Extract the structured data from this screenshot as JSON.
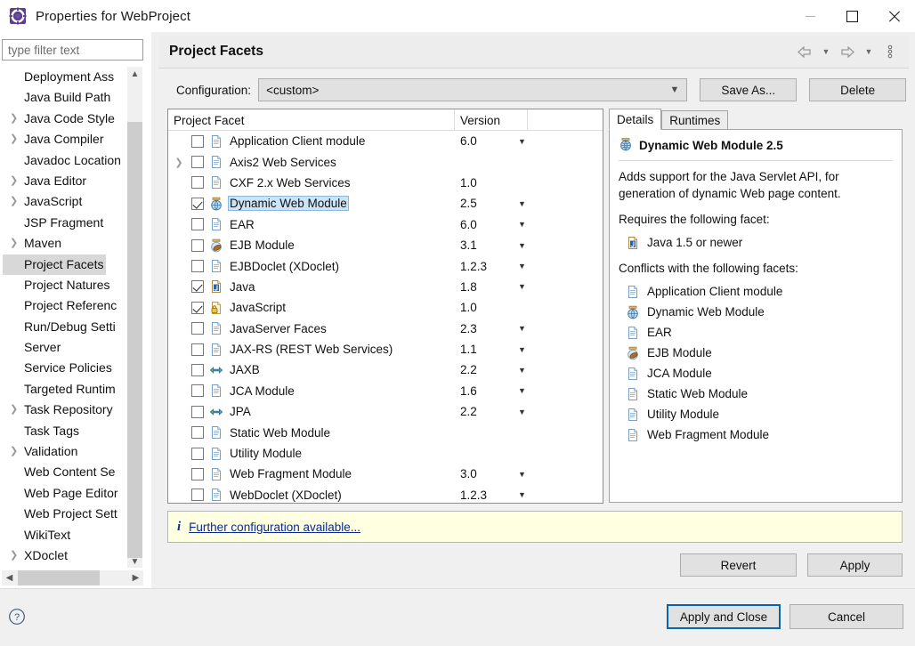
{
  "window": {
    "title": "Properties for WebProject",
    "app_icon": "eclipse-properties-icon",
    "minimize": "minimize-icon",
    "maximize": "maximize-icon",
    "close": "close-icon"
  },
  "sidebar": {
    "filter_placeholder": "type filter text",
    "filter_value": "",
    "items": [
      {
        "label": "Deployment Ass",
        "expandable": false,
        "selected": false
      },
      {
        "label": "Java Build Path",
        "expandable": false,
        "selected": false
      },
      {
        "label": "Java Code Style",
        "expandable": true,
        "selected": false
      },
      {
        "label": "Java Compiler",
        "expandable": true,
        "selected": false
      },
      {
        "label": "Javadoc Location",
        "expandable": false,
        "selected": false
      },
      {
        "label": "Java Editor",
        "expandable": true,
        "selected": false
      },
      {
        "label": "JavaScript",
        "expandable": true,
        "selected": false
      },
      {
        "label": "JSP Fragment",
        "expandable": false,
        "selected": false
      },
      {
        "label": "Maven",
        "expandable": true,
        "selected": false
      },
      {
        "label": "Project Facets",
        "expandable": false,
        "selected": true
      },
      {
        "label": "Project Natures",
        "expandable": false,
        "selected": false
      },
      {
        "label": "Project Referenc",
        "expandable": false,
        "selected": false
      },
      {
        "label": "Run/Debug Setti",
        "expandable": false,
        "selected": false
      },
      {
        "label": "Server",
        "expandable": false,
        "selected": false
      },
      {
        "label": "Service Policies",
        "expandable": false,
        "selected": false
      },
      {
        "label": "Targeted Runtim",
        "expandable": false,
        "selected": false
      },
      {
        "label": "Task Repository",
        "expandable": true,
        "selected": false
      },
      {
        "label": "Task Tags",
        "expandable": false,
        "selected": false
      },
      {
        "label": "Validation",
        "expandable": true,
        "selected": false
      },
      {
        "label": "Web Content Se",
        "expandable": false,
        "selected": false
      },
      {
        "label": "Web Page Editor",
        "expandable": false,
        "selected": false
      },
      {
        "label": "Web Project Sett",
        "expandable": false,
        "selected": false
      },
      {
        "label": "WikiText",
        "expandable": false,
        "selected": false
      },
      {
        "label": "XDoclet",
        "expandable": true,
        "selected": false
      }
    ],
    "scroll_up": "scroll-up-arrow",
    "scroll_down": "scroll-down-arrow",
    "scroll_left": "scroll-left-arrow",
    "scroll_right": "scroll-right-arrow"
  },
  "page": {
    "title": "Project Facets",
    "nav_back": "back-arrow-icon",
    "nav_forward": "forward-arrow-icon",
    "menu": "view-menu-icon"
  },
  "configuration": {
    "label": "Configuration:",
    "value": "<custom>",
    "save_as_label": "Save As...",
    "delete_label": "Delete"
  },
  "facets_table": {
    "columns": [
      "Project Facet",
      "Version"
    ],
    "rows": [
      {
        "name": "Application Client module",
        "version": "6.0",
        "checked": false,
        "expandable": false,
        "has_version_menu": true,
        "icon": "doc-icon"
      },
      {
        "name": "Axis2 Web Services",
        "version": "",
        "checked": false,
        "expandable": true,
        "has_version_menu": false,
        "icon": "doc-icon"
      },
      {
        "name": "CXF 2.x Web Services",
        "version": "1.0",
        "checked": false,
        "expandable": false,
        "has_version_menu": false,
        "icon": "doc-icon"
      },
      {
        "name": "Dynamic Web Module",
        "version": "2.5",
        "checked": true,
        "expandable": false,
        "has_version_menu": true,
        "icon": "web-module-icon",
        "selected": true
      },
      {
        "name": "EAR",
        "version": "6.0",
        "checked": false,
        "expandable": false,
        "has_version_menu": true,
        "icon": "doc-icon"
      },
      {
        "name": "EJB Module",
        "version": "3.1",
        "checked": false,
        "expandable": false,
        "has_version_menu": true,
        "icon": "ejb-module-icon"
      },
      {
        "name": "EJBDoclet (XDoclet)",
        "version": "1.2.3",
        "checked": false,
        "expandable": false,
        "has_version_menu": true,
        "icon": "doc-icon"
      },
      {
        "name": "Java",
        "version": "1.8",
        "checked": true,
        "expandable": false,
        "has_version_menu": true,
        "icon": "java-icon"
      },
      {
        "name": "JavaScript",
        "version": "1.0",
        "checked": true,
        "expandable": false,
        "has_version_menu": false,
        "icon": "javascript-icon"
      },
      {
        "name": "JavaServer Faces",
        "version": "2.3",
        "checked": false,
        "expandable": false,
        "has_version_menu": true,
        "icon": "doc-icon"
      },
      {
        "name": "JAX-RS (REST Web Services)",
        "version": "1.1",
        "checked": false,
        "expandable": false,
        "has_version_menu": true,
        "icon": "doc-icon"
      },
      {
        "name": "JAXB",
        "version": "2.2",
        "checked": false,
        "expandable": false,
        "has_version_menu": true,
        "icon": "jaxb-icon"
      },
      {
        "name": "JCA Module",
        "version": "1.6",
        "checked": false,
        "expandable": false,
        "has_version_menu": true,
        "icon": "doc-icon"
      },
      {
        "name": "JPA",
        "version": "2.2",
        "checked": false,
        "expandable": false,
        "has_version_menu": true,
        "icon": "jaxb-icon"
      },
      {
        "name": "Static Web Module",
        "version": "",
        "checked": false,
        "expandable": false,
        "has_version_menu": false,
        "icon": "doc-icon"
      },
      {
        "name": "Utility Module",
        "version": "",
        "checked": false,
        "expandable": false,
        "has_version_menu": false,
        "icon": "doc-icon"
      },
      {
        "name": "Web Fragment Module",
        "version": "3.0",
        "checked": false,
        "expandable": false,
        "has_version_menu": true,
        "icon": "doc-icon"
      },
      {
        "name": "WebDoclet (XDoclet)",
        "version": "1.2.3",
        "checked": false,
        "expandable": false,
        "has_version_menu": true,
        "icon": "doc-icon"
      }
    ]
  },
  "details": {
    "tabs": [
      {
        "label": "Details",
        "active": true
      },
      {
        "label": "Runtimes",
        "active": false
      }
    ],
    "title": "Dynamic Web Module 2.5",
    "title_icon": "web-module-icon",
    "description": "Adds support for the Java Servlet API, for generation of dynamic Web page content.",
    "requires_heading": "Requires the following facet:",
    "requires": [
      {
        "label": "Java 1.5 or newer",
        "icon": "java-icon"
      }
    ],
    "conflicts_heading": "Conflicts with the following facets:",
    "conflicts": [
      {
        "label": "Application Client module",
        "icon": "doc-icon"
      },
      {
        "label": "Dynamic Web Module",
        "icon": "web-module-icon"
      },
      {
        "label": "EAR",
        "icon": "doc-icon"
      },
      {
        "label": "EJB Module",
        "icon": "ejb-module-icon"
      },
      {
        "label": "JCA Module",
        "icon": "doc-icon"
      },
      {
        "label": "Static Web Module",
        "icon": "doc-icon"
      },
      {
        "label": "Utility Module",
        "icon": "doc-icon"
      },
      {
        "label": "Web Fragment Module",
        "icon": "doc-icon"
      }
    ]
  },
  "info_bar": {
    "icon": "info-icon",
    "link_text": "Further configuration available...",
    "background": "#ffffe1"
  },
  "buttons": {
    "revert": "Revert",
    "apply": "Apply",
    "apply_and_close": "Apply and Close",
    "cancel": "Cancel",
    "help_icon": "help-icon"
  },
  "colors": {
    "accent_focus": "#0a64ad",
    "selection": "#cce4f7",
    "sidebar_selection": "#d8d8d8",
    "info_bg": "#ffffe1",
    "link": "#0b2a8f"
  }
}
